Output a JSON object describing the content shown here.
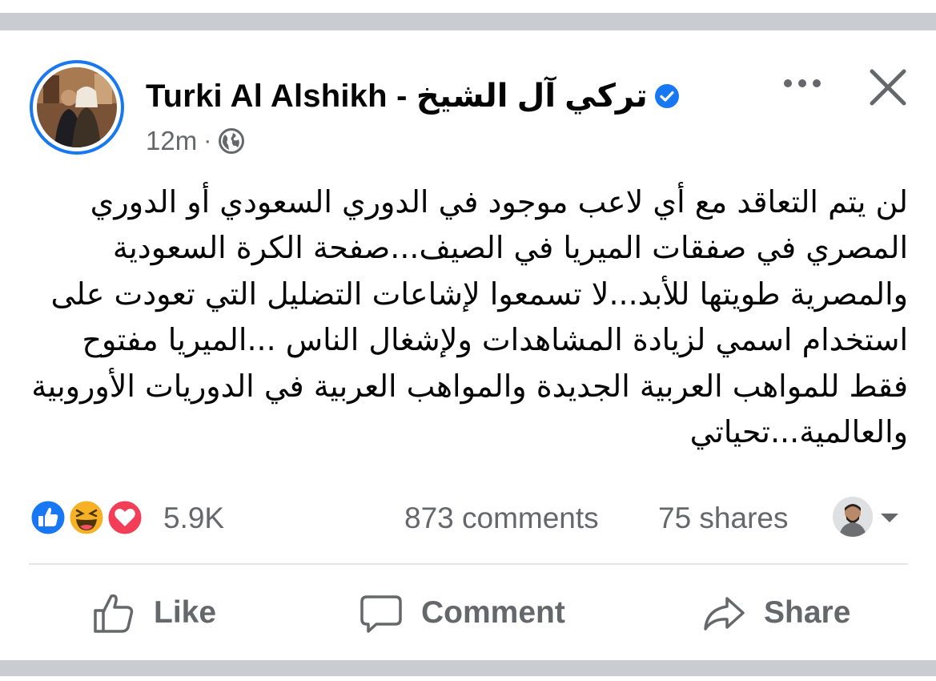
{
  "post": {
    "author_name": "Turki Al Alshikh - تركي آل الشيخ",
    "verified": true,
    "time": "12m",
    "separator": "·",
    "privacy_icon": "globe-icon",
    "text": "لن يتم التعاقد مع أي لاعب موجود في الدوري السعودي أو الدوري المصري في صفقات الميريا في الصيف...صفحة الكرة السعودية والمصرية طويتها للأبد...لا تسمعوا لإشاعات التضليل التي تعودت على استخدام اسمي لزيادة المشاهدات ولإشغال الناس ...الميريا مفتوح فقط للمواهب العربية الجديدة والمواهب العربية في الدوريات الأوروبية والعالمية...تحياتي"
  },
  "reactions": {
    "icons": [
      "like-reaction-icon",
      "haha-reaction-icon",
      "love-reaction-icon"
    ],
    "count": "5.9K",
    "comments": "873 comments",
    "shares": "75 shares"
  },
  "actions": {
    "like": "Like",
    "comment": "Comment",
    "share": "Share"
  },
  "colors": {
    "accent": "#1877f2",
    "secondary_text": "#65676b",
    "love": "#f33e58",
    "haha": "#f7b125",
    "band": "#c9ccd1"
  }
}
